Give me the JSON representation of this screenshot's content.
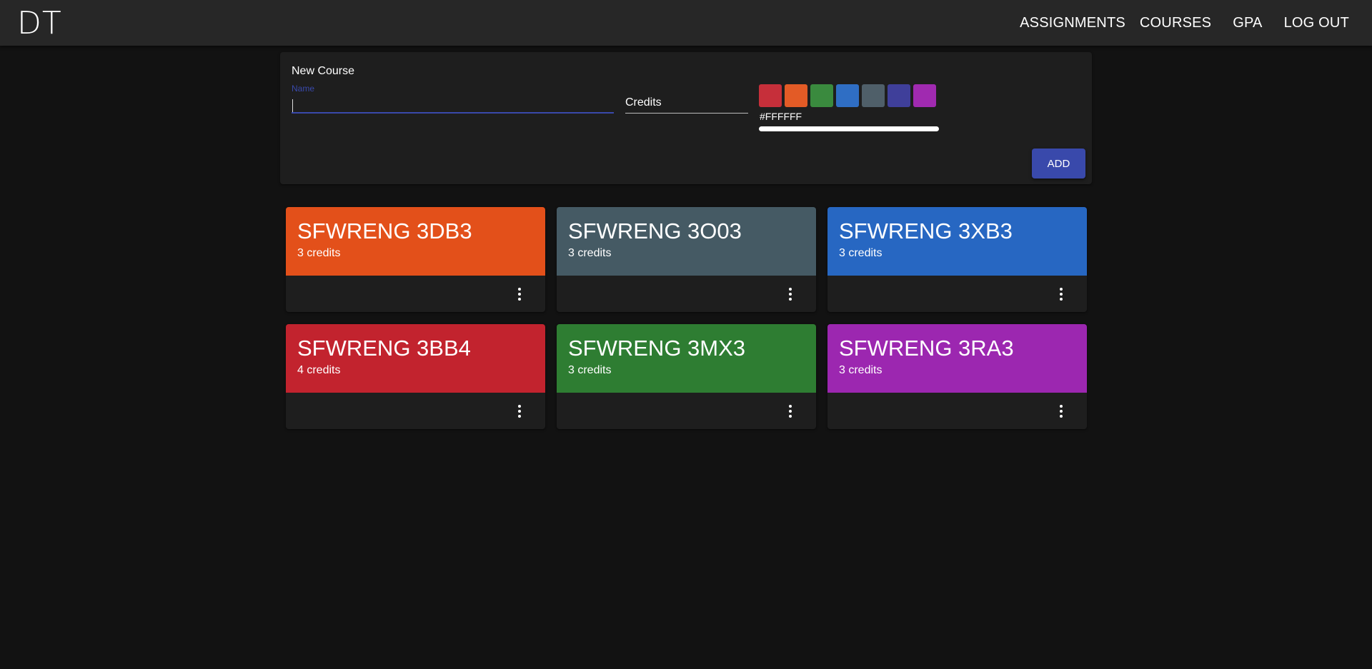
{
  "header": {
    "logo": "DT",
    "nav": [
      "ASSIGNMENTS",
      "COURSES",
      "GPA",
      "LOG OUT"
    ]
  },
  "new_course": {
    "title": "New Course",
    "name_label": "Name",
    "name_value": "",
    "credits_placeholder": "Credits",
    "color_hex": "#FFFFFF",
    "swatches": [
      "#c62f3a",
      "#e35b26",
      "#3a8a3e",
      "#2f6ec4",
      "#4f5f69",
      "#3f3f9a",
      "#a02ab0"
    ],
    "add_label": "ADD"
  },
  "courses": [
    {
      "name": "SFWRENG 3DB3",
      "credits": "3 credits",
      "color": "#e3501a"
    },
    {
      "name": "SFWRENG 3O03",
      "credits": "3 credits",
      "color": "#455a64"
    },
    {
      "name": "SFWRENG 3XB3",
      "credits": "3 credits",
      "color": "#2767c2"
    },
    {
      "name": "SFWRENG 3BB4",
      "credits": "4 credits",
      "color": "#c2232e"
    },
    {
      "name": "SFWRENG 3MX3",
      "credits": "3 credits",
      "color": "#2e7d32"
    },
    {
      "name": "SFWRENG 3RA3",
      "credits": "3 credits",
      "color": "#9c27b0"
    }
  ]
}
